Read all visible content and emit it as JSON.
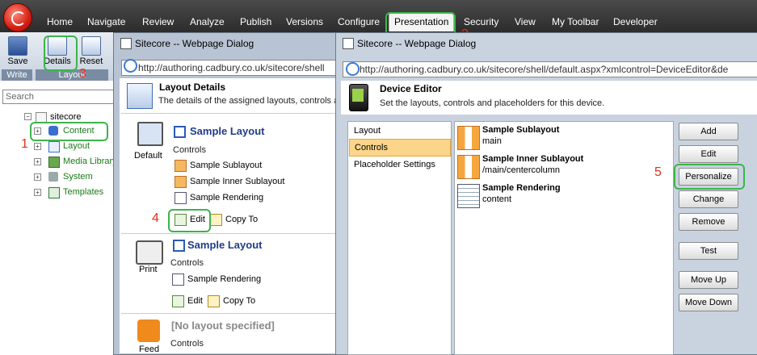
{
  "menubar": {
    "items": [
      "Home",
      "Navigate",
      "Review",
      "Analyze",
      "Publish",
      "Versions",
      "Configure",
      "Presentation",
      "Security",
      "View",
      "My Toolbar",
      "Developer"
    ],
    "active": "Presentation"
  },
  "ribbon": {
    "save": "Save",
    "write_group": "Write",
    "details": "Details",
    "reset": "Reset",
    "layout_group": "Layout"
  },
  "left": {
    "search_placeholder": "Search",
    "tree": {
      "root": "sitecore",
      "children": [
        "Content",
        "Layout",
        "Media Library",
        "System",
        "Templates"
      ]
    }
  },
  "annotations": {
    "n1": "1",
    "n2": "2",
    "n3": "3",
    "n4": "4",
    "n5": "5"
  },
  "dialog1": {
    "title": "Sitecore -- Webpage Dialog",
    "address": "http://authoring.cadbury.co.uk/sitecore/shell",
    "header": "Layout Details",
    "description": "The details of the assigned layouts, controls a",
    "devices": [
      {
        "name": "Default",
        "layout": "Sample Layout",
        "controls_label": "Controls",
        "controls": [
          "Sample Sublayout",
          "Sample Inner Sublayout",
          "Sample Rendering"
        ],
        "edit": "Edit",
        "copy": "Copy To"
      },
      {
        "name": "Print",
        "layout": "Sample Layout",
        "controls_label": "Controls",
        "controls": [
          "Sample Rendering"
        ],
        "edit": "Edit",
        "copy": "Copy To"
      },
      {
        "name": "Feed",
        "layout": "[No layout specified]",
        "controls_label": "Controls"
      }
    ]
  },
  "dialog2": {
    "title": "Sitecore -- Webpage Dialog",
    "address": "http://authoring.cadbury.co.uk/sitecore/shell/default.aspx?xmlcontrol=DeviceEditor&de",
    "header": "Device Editor",
    "description": "Set the layouts, controls and placeholders for this device.",
    "tabs": [
      "Layout",
      "Controls",
      "Placeholder Settings"
    ],
    "selected_tab": "Controls",
    "renderings": [
      {
        "name": "Sample Sublayout",
        "placeholder": "main"
      },
      {
        "name": "Sample Inner Sublayout",
        "placeholder": "/main/centercolumn"
      },
      {
        "name": "Sample Rendering",
        "placeholder": "content"
      }
    ],
    "buttons": [
      "Add",
      "Edit",
      "Personalize",
      "Change",
      "Remove",
      "Test",
      "Move Up",
      "Move Down"
    ]
  }
}
